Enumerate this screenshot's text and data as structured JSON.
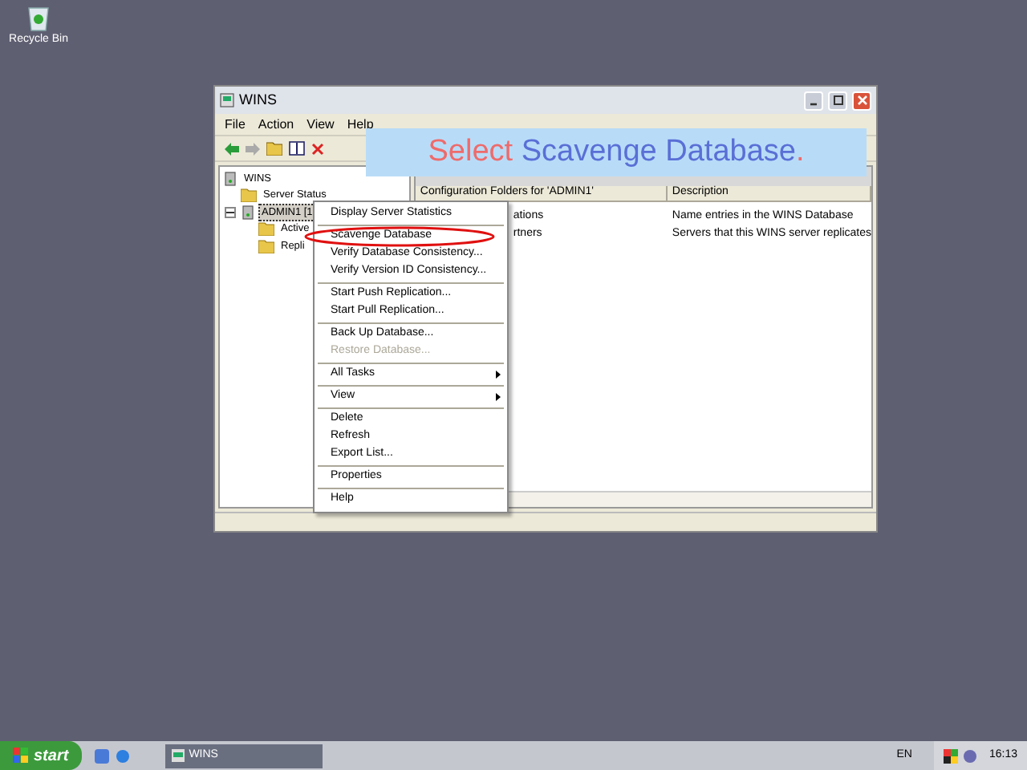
{
  "desktop_icons": [
    {
      "label": "Recycle Bin"
    }
  ],
  "window": {
    "title": "WINS",
    "active": true
  },
  "menu_bar": [
    "File",
    "Action",
    "View",
    "Help"
  ],
  "tree": [
    {
      "label": "WINS",
      "selected": false,
      "children": [
        {
          "label": "Server Status",
          "selected": false
        },
        {
          "label": "ADMIN1 [1",
          "selected": true,
          "expanded": true,
          "children": [
            {
              "label": "Active",
              "selected": false
            },
            {
              "label": "Repli",
              "selected": false
            }
          ]
        }
      ]
    }
  ],
  "table": {
    "columns": [
      "Configuration Folders for 'ADMIN1'",
      "Description"
    ],
    "rows": [
      [
        "ations",
        "Name entries in the WINS Database"
      ],
      [
        "rtners",
        "Servers that this WINS server replicates"
      ]
    ]
  },
  "context_menu": [
    {
      "kind": "item",
      "label": "Display Server Statistics",
      "disabled": false,
      "submenu": false
    },
    {
      "kind": "separator"
    },
    {
      "kind": "item",
      "label": "Scavenge Database",
      "disabled": false,
      "submenu": false
    },
    {
      "kind": "item",
      "label": "Verify Database Consistency...",
      "disabled": false,
      "submenu": false
    },
    {
      "kind": "item",
      "label": "Verify Version ID Consistency...",
      "disabled": false,
      "submenu": false
    },
    {
      "kind": "separator"
    },
    {
      "kind": "item",
      "label": "Start Push Replication...",
      "disabled": false,
      "submenu": false
    },
    {
      "kind": "item",
      "label": "Start Pull Replication...",
      "disabled": false,
      "submenu": false
    },
    {
      "kind": "separator"
    },
    {
      "kind": "item",
      "label": "Back Up Database...",
      "disabled": false,
      "submenu": false
    },
    {
      "kind": "item",
      "label": "Restore Database...",
      "disabled": true,
      "submenu": false
    },
    {
      "kind": "separator"
    },
    {
      "kind": "item",
      "label": "All Tasks",
      "disabled": false,
      "submenu": true
    },
    {
      "kind": "separator"
    },
    {
      "kind": "item",
      "label": "View",
      "disabled": false,
      "submenu": true
    },
    {
      "kind": "separator"
    },
    {
      "kind": "item",
      "label": "Delete",
      "disabled": false,
      "submenu": false
    },
    {
      "kind": "item",
      "label": "Refresh",
      "disabled": false,
      "submenu": false
    },
    {
      "kind": "item",
      "label": "Export List...",
      "disabled": false,
      "submenu": false
    },
    {
      "kind": "separator"
    },
    {
      "kind": "item",
      "label": "Properties",
      "disabled": false,
      "submenu": false
    },
    {
      "kind": "separator"
    },
    {
      "kind": "item",
      "label": "Help",
      "disabled": false,
      "submenu": false
    }
  ],
  "callout": [
    {
      "text": "Select",
      "color": "#ee6b6b"
    },
    {
      "text": " Scavenge Database",
      "color": "#5a6fd6"
    },
    {
      "text": ".",
      "color": "#ee6b6b"
    }
  ],
  "taskbar": {
    "start": "start",
    "tasks": [
      {
        "label": "WINS",
        "selected": false
      }
    ],
    "language": "EN",
    "clock": "16:13"
  }
}
